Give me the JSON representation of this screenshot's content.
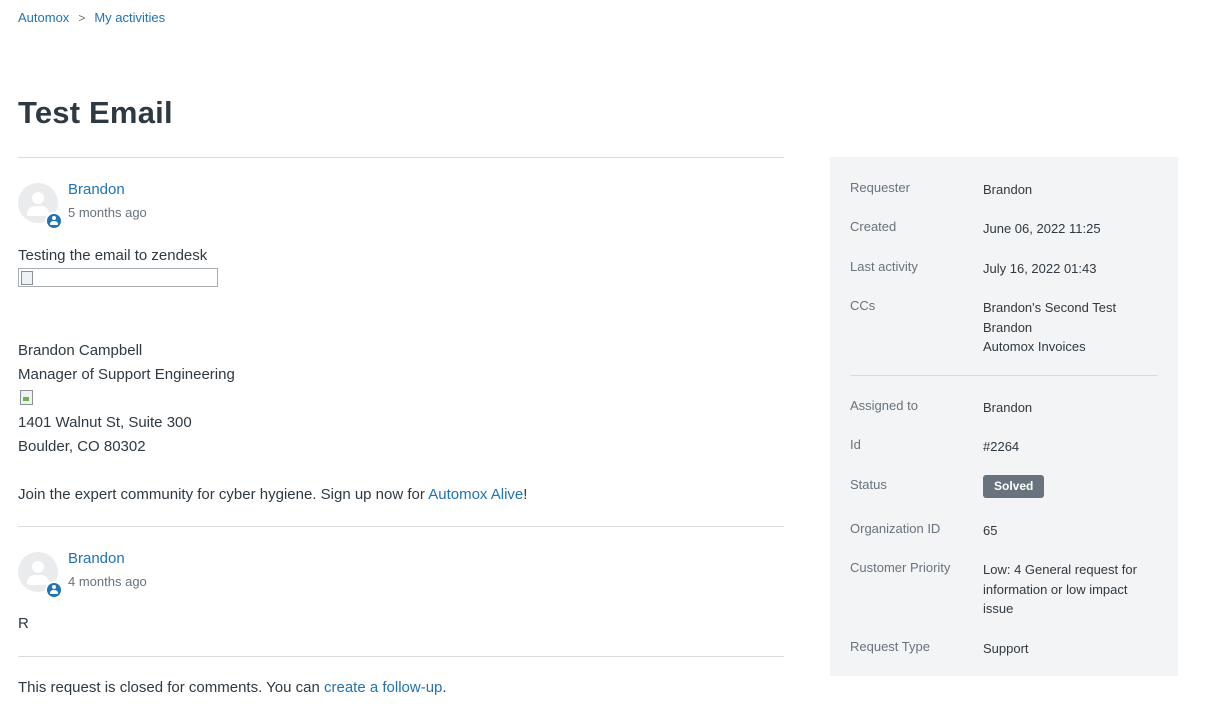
{
  "breadcrumbs": [
    {
      "label": "Automox"
    },
    {
      "label": "My activities"
    }
  ],
  "breadcrumb_separator": ">",
  "page_title": "Test Email",
  "comments": [
    {
      "author": "Brandon",
      "time": "5 months ago",
      "lines": {
        "intro": "Testing the email to zendesk",
        "name": "Brandon Campbell",
        "role": "Manager of Support Engineering",
        "street": "1401 Walnut St, Suite 300",
        "city": "Boulder, CO 80302",
        "promo_prefix": "Join the expert community for cyber hygiene. Sign up now for ",
        "promo_link": "Automox Alive",
        "promo_suffix": "!"
      }
    },
    {
      "author": "Brandon",
      "time": "4 months ago",
      "body": "R"
    }
  ],
  "closed_note": {
    "prefix": "This request is closed for comments. You can ",
    "link": "create a follow-up",
    "suffix": "."
  },
  "sidebar": {
    "requester": {
      "label": "Requester",
      "value": "Brandon"
    },
    "created": {
      "label": "Created",
      "value": "June 06, 2022 11:25"
    },
    "last_activity": {
      "label": "Last activity",
      "value": "July 16, 2022 01:43"
    },
    "ccs": {
      "label": "CCs",
      "values": [
        "Brandon's Second Test Brandon",
        "Automox Invoices"
      ]
    },
    "assigned_to": {
      "label": "Assigned to",
      "value": "Brandon"
    },
    "id": {
      "label": "Id",
      "value": "#2264"
    },
    "status": {
      "label": "Status",
      "value": "Solved"
    },
    "organization_id": {
      "label": "Organization ID",
      "value": "65"
    },
    "customer_priority": {
      "label": "Customer Priority",
      "value": "Low: 4 General request for information or low impact issue"
    },
    "request_type": {
      "label": "Request Type",
      "value": "Support"
    }
  },
  "colors": {
    "link": "#1f73b7",
    "text": "#2f3941",
    "muted": "#68737d",
    "sidebar_bg": "#f3f4f5",
    "status_solved": "#68737d"
  },
  "icons": {
    "avatar": "user-avatar-icon",
    "agent_badge": "agent-badge-icon",
    "broken_image": "broken-image-icon"
  }
}
